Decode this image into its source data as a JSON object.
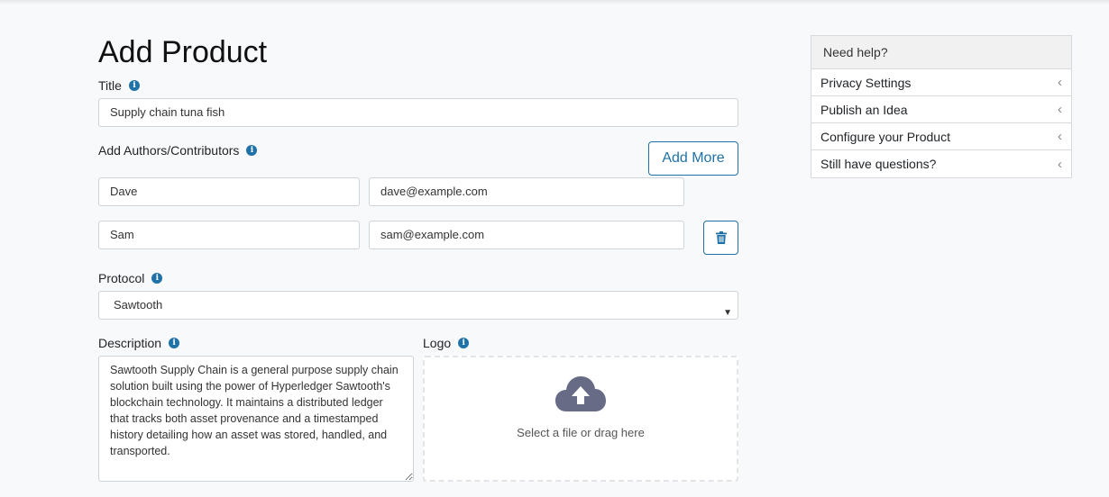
{
  "page": {
    "title": "Add Product"
  },
  "title_field": {
    "label": "Title",
    "value": "Supply chain tuna fish"
  },
  "authors": {
    "label": "Add Authors/Contributors",
    "add_more_label": "Add More",
    "rows": [
      {
        "name": "Dave",
        "email": "dave@example.com"
      },
      {
        "name": "Sam",
        "email": "sam@example.com"
      }
    ]
  },
  "protocol": {
    "label": "Protocol",
    "selected": "Sawtooth"
  },
  "description": {
    "label": "Description",
    "value": "Sawtooth Supply Chain is a general purpose supply chain solution built using the power of Hyperledger Sawtooth's blockchain technology. It maintains a distributed ledger that tracks both asset provenance and a timestamped history detailing how an asset was stored, handled, and transported."
  },
  "logo": {
    "label": "Logo",
    "dropzone_text": "Select a file or drag here"
  },
  "help": {
    "header": "Need help?",
    "items": [
      {
        "label": "Privacy Settings"
      },
      {
        "label": "Publish an Idea"
      },
      {
        "label": "Configure your Product"
      },
      {
        "label": "Still have questions?"
      }
    ]
  },
  "colors": {
    "accent": "#1f72a7",
    "icon_gray": "#676b85"
  },
  "icons": {
    "info": "info-icon",
    "trash": "trash-icon",
    "upload": "cloud-upload-icon",
    "chevron": "chevron-left-icon"
  }
}
